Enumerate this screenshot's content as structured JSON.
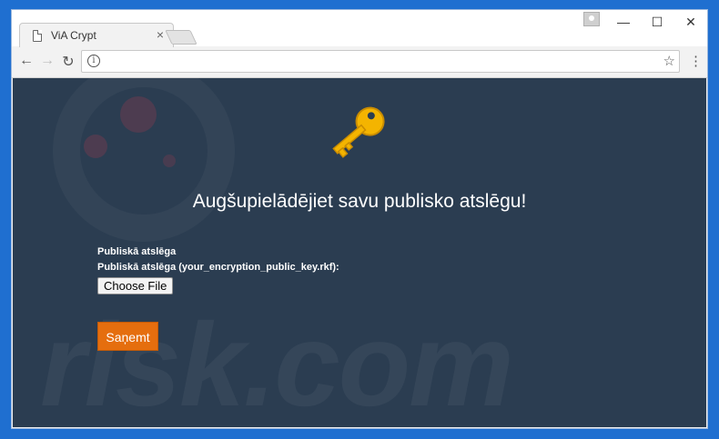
{
  "tab": {
    "title": "ViA Crypt",
    "close": "×"
  },
  "window_controls": {
    "minimize": "—",
    "maximize": "☐",
    "close": "✕"
  },
  "nav": {
    "back": "←",
    "forward": "→",
    "reload": "↻",
    "info": "i",
    "star": "☆",
    "menu": "⋮"
  },
  "address": {
    "url": ""
  },
  "page": {
    "heading": "Augšupielādējiet savu publisko atslēgu!",
    "label_public_key": "Publiskā atslēga",
    "label_file": "Publiskā atslēga (your_encryption_public_key.rkf):",
    "choose_file": "Choose File",
    "submit": "Saņemt"
  },
  "watermark": {
    "text": "risk.com"
  },
  "colors": {
    "background": "#2b3d51",
    "button_orange": "#e56e0e",
    "key_gold": "#f4b400",
    "desktop_blue": "#1f6fd0"
  },
  "icons": {
    "key": "key-icon",
    "page": "page-icon",
    "profile": "profile-icon"
  }
}
